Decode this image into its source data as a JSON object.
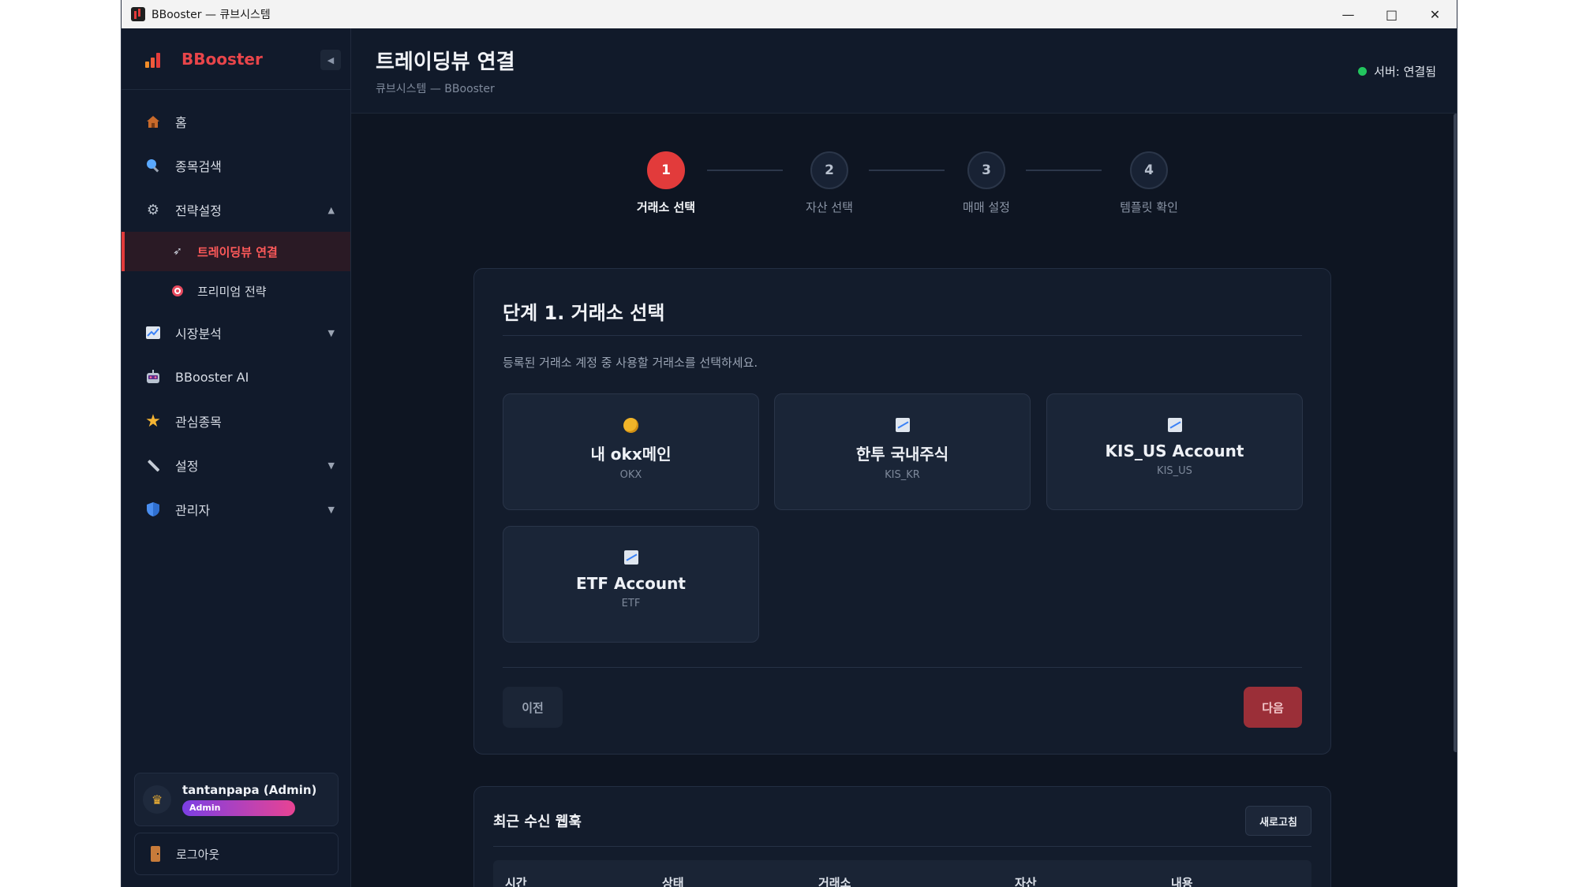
{
  "window": {
    "title": "BBooster — 큐브시스템"
  },
  "sidebar": {
    "brand": "BBooster",
    "items": [
      {
        "label": "홈",
        "icon": "home-icon"
      },
      {
        "label": "종목검색",
        "icon": "search-icon"
      },
      {
        "label": "전략설정",
        "icon": "gear-icon",
        "expanded": true,
        "children": [
          {
            "label": "트레이딩뷰 연결",
            "icon": "rocket-icon",
            "active": true
          },
          {
            "label": "프리미엄 전략",
            "icon": "target-icon"
          }
        ]
      },
      {
        "label": "시장분석",
        "icon": "chart-icon"
      },
      {
        "label": "BBooster AI",
        "icon": "robot-icon"
      },
      {
        "label": "관심종목",
        "icon": "star-icon"
      },
      {
        "label": "설정",
        "icon": "wrench-icon"
      },
      {
        "label": "관리자",
        "icon": "shield-icon"
      }
    ],
    "user": {
      "name": "tantanpapa (Admin)",
      "role": "Admin"
    },
    "logout": "로그아웃"
  },
  "header": {
    "title": "트레이딩뷰 연결",
    "subtitle": "큐브시스템 — BBooster",
    "server_status": "서버: 연결됨"
  },
  "stepper": {
    "current": 1,
    "steps": [
      {
        "num": "1",
        "label": "거래소 선택"
      },
      {
        "num": "2",
        "label": "자산 선택"
      },
      {
        "num": "3",
        "label": "매매 설정"
      },
      {
        "num": "4",
        "label": "템플릿 확인"
      }
    ]
  },
  "step_card": {
    "title": "단계 1. 거래소 선택",
    "description": "등록된 거래소 계정 중 사용할 거래소를 선택하세요.",
    "exchanges": [
      {
        "name": "내 okx메인",
        "code": "OKX",
        "icon": "coin-icon"
      },
      {
        "name": "한투 국내주식",
        "code": "KIS_KR",
        "icon": "chart-icon"
      },
      {
        "name": "KIS_US Account",
        "code": "KIS_US",
        "icon": "chart-icon"
      },
      {
        "name": "ETF Account",
        "code": "ETF",
        "icon": "chart-icon"
      }
    ],
    "prev_label": "이전",
    "next_label": "다음"
  },
  "webhooks": {
    "title": "최근 수신 웹훅",
    "refresh_label": "새로고침",
    "columns": [
      "시간",
      "상태",
      "거래소",
      "자산",
      "내용"
    ]
  },
  "colors": {
    "accent": "#e23b3b",
    "status_ok": "#22c55e",
    "background": "#0e1522"
  }
}
